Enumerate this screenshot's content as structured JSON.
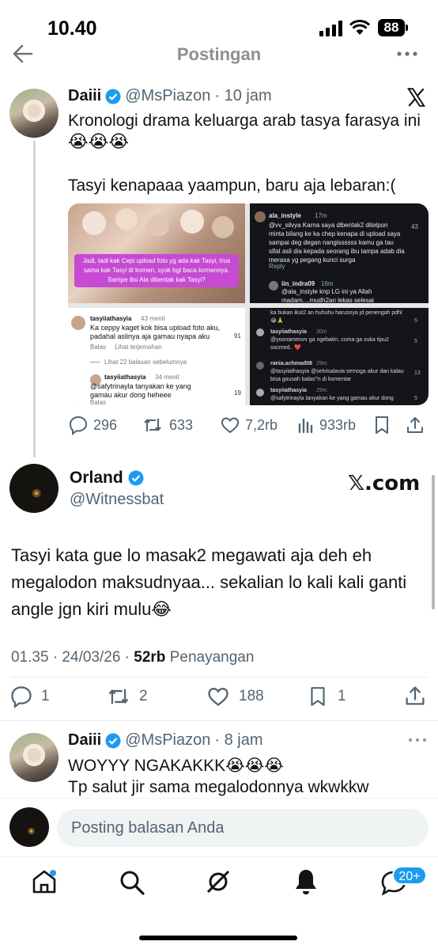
{
  "status_bar": {
    "time": "10.40",
    "battery": "88"
  },
  "header": {
    "title": "Postingan"
  },
  "quoted_post": {
    "name": "Daiii",
    "handle": "@MsPiazon",
    "time": "· 10 jam",
    "text_line1": "Kronologi drama keluarga arab tasya farasya ini",
    "emojis1": "😭😭😭",
    "text_line2": "Tasyi kenapaaa yaampun, baru aja lebaran:(",
    "media": {
      "caption": "Jadi, tadi kak Cepi upload foto yg ada kak Tasyi, trus sama kak Tasyi di komen, syok bgt baca komennya. Sampe ibu Ala dibentak kak Tasyi?",
      "c1_user": "ala_instyle",
      "c1_time": "17m",
      "c1_text": "@vv_silvya Karna saya dibentak2 ditelpon minta bilang ke ka chep kenapa di upload saya sampai deg degan nangissssss kamu ga tau sifat asli dia kepada seorang ibu tampa adab dia merasa yg pegang kunci surga",
      "c1_reply": "Reply",
      "c1_likes": "43",
      "c2_user": "iin_indra09",
      "c2_time": "16m",
      "c2_text": "@ala_instyle knp LG ini ya Allah madam....mudh2an lekas selesai",
      "c3_user": "tasyiiathasyia",
      "c3_time": "43 menit",
      "c3_text": "Ka ceppy kaget kok bisa upload foto aku, padahal aslinya aja gamau nyapa aku",
      "c3_actions": "Balas     Lihat terjemahan",
      "c3_likes": "91",
      "c3_more": "Lihat 22 balasan sebelumnya",
      "c4_user": "tasyiiathasyia",
      "c4_time": "34 menit",
      "c4_text": "@safytrinayla tanyakan ke yang gamau akur dong heheee",
      "c4_reply": "Balas",
      "c4_likes": "19",
      "c5_text": "ka bukan ikut2 an huhuhu harusnya jd penengah pdhl 😭🙏",
      "c6_user": "tasyiiathasyia",
      "c6_time": "30m",
      "c6_text": "@yoonameovv ga ngebatin, cuma ga suka tipu2 socmed.. ❤️",
      "c7_user": "rania.achmad08",
      "c7_time": "29m",
      "c7_text": "@tasyiiathasyia @selvisalavia semoga akur dan kalau bisa gausah balas^n di komentar",
      "c8_user": "tasyiiathasyia",
      "c8_time": "29m",
      "c8_text": "@safytrinayla tanyakan ke yang gamau akur dong",
      "right_counts": [
        "5",
        "5",
        "13",
        "5"
      ]
    },
    "stats": {
      "replies": "296",
      "reposts": "633",
      "likes": "7,2rb",
      "views": "933rb"
    }
  },
  "main_post": {
    "name": "Orland",
    "handle": "@Witnessbat",
    "brand": "𝕏.com",
    "text": "Tasyi kata gue lo masak2 megawati aja deh eh megalodon maksudnyaa... sekalian lo kali kali ganti angle jgn kiri mulu😂",
    "timestamp": "01.35 · 24/03/26 · ",
    "views_count": "52rb",
    "views_label": " Penayangan",
    "stats": {
      "replies": "1",
      "reposts": "2",
      "likes": "188",
      "bookmarks": "1"
    }
  },
  "reply_post": {
    "name": "Daiii",
    "handle": "@MsPiazon",
    "time": "· 8 jam",
    "text_line1": "WOYYY NGAKAKKK😭😭😭",
    "text_line2": "Tp salut jir sama megalodonnya wkwkkw"
  },
  "composer": {
    "placeholder": "Posting balasan Anda"
  },
  "bottom_nav": {
    "messages_badge": "20+"
  },
  "colors": {
    "accent": "#1d9bf0",
    "text": "#0f1419",
    "muted": "#536471"
  }
}
